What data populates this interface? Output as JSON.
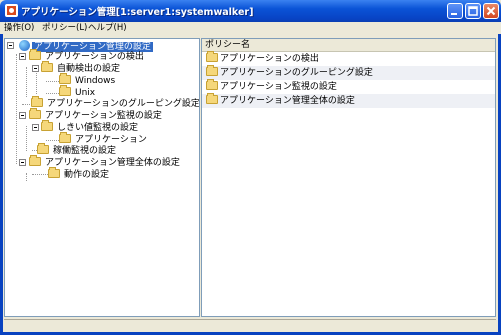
{
  "window": {
    "title": "アプリケーション管理[1:server1:systemwalker]"
  },
  "menu": [
    {
      "label": "操作(O)"
    },
    {
      "label": "ポリシー(L)"
    },
    {
      "label": "ヘルプ(H)"
    }
  ],
  "tree": {
    "root": "アプリケーション管理の設定",
    "detect": "アプリケーションの検出",
    "auto_detect": "自動検出の設定",
    "windows": "Windows",
    "unix": "Unix",
    "grouping": "アプリケーションのグルーピング設定",
    "monitor": "アプリケーション監視の設定",
    "threshold": "しきい値監視の設定",
    "application": "アプリケーション",
    "operation_monitor": "稼働監視の設定",
    "overall": "アプリケーション管理全体の設定",
    "behavior": "動作の設定"
  },
  "list": {
    "header": "ポリシー名",
    "rows": [
      {
        "name": "アプリケーションの検出"
      },
      {
        "name": "アプリケーションのグルーピング設定"
      },
      {
        "name": "アプリケーション監視の設定"
      },
      {
        "name": "アプリケーション管理全体の設定"
      }
    ]
  }
}
